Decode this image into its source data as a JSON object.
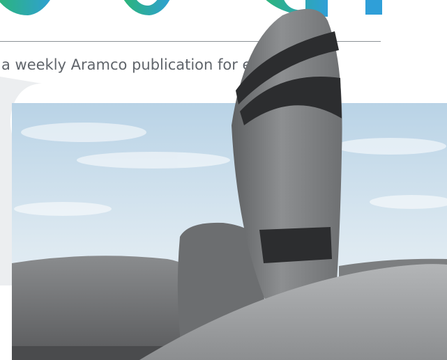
{
  "masthead": {
    "logo_name": "publication-logo",
    "logo_colors": [
      "#2bb673",
      "#2f9fd8"
    ]
  },
  "tagline": "a weekly Aramco publication for employees",
  "hero_image": {
    "subject": "curved concrete building with dark window bands against a cloudy sky",
    "sky_color": "#cfe0ec",
    "concrete_color": "#77797b"
  }
}
